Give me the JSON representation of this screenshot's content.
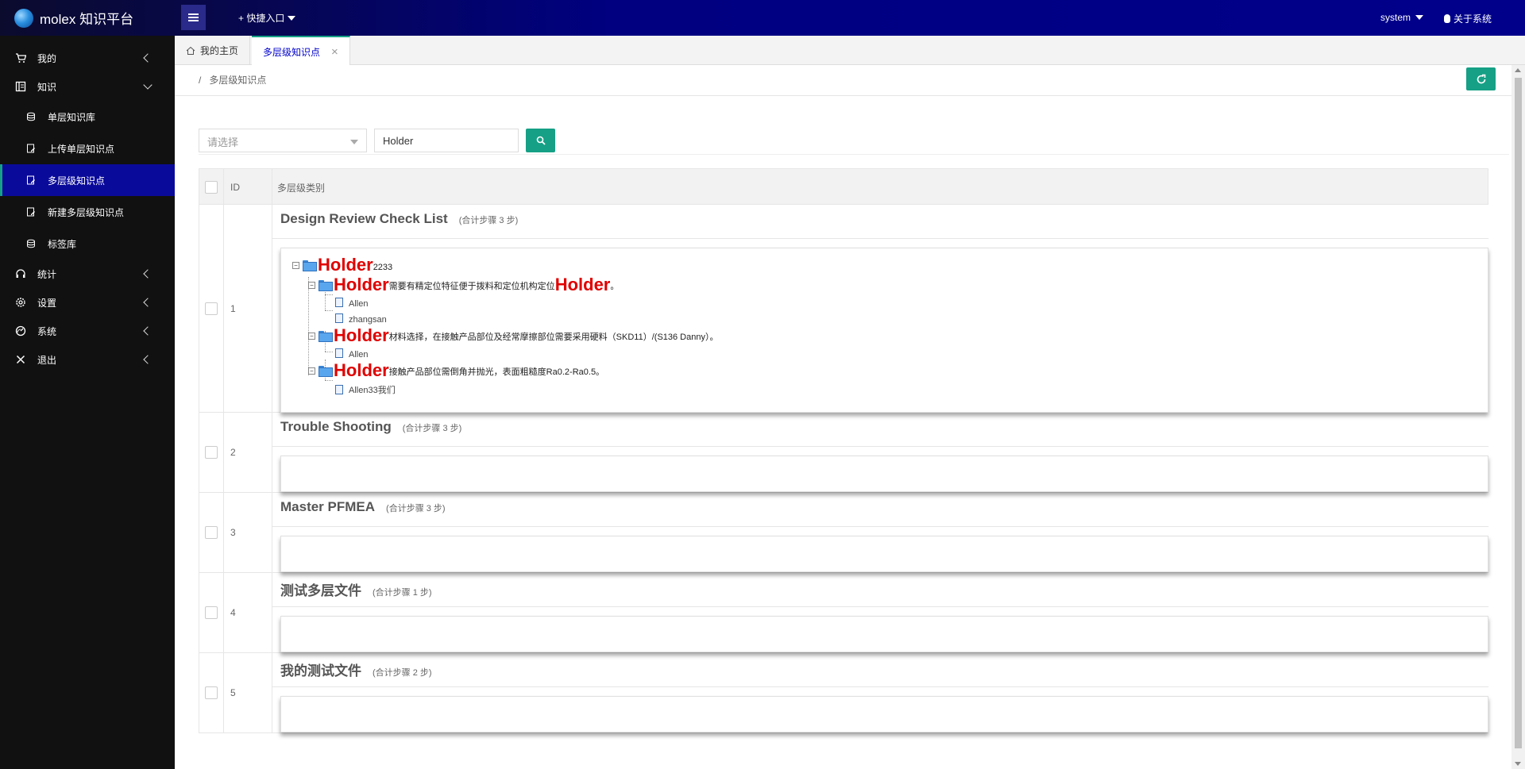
{
  "header": {
    "brand": "molex 知识平台",
    "quick_entry": "+ 快捷入口",
    "user": "system",
    "about": "关于系统"
  },
  "sidebar": {
    "items": [
      {
        "label": "我的",
        "icon": "cart-icon"
      },
      {
        "label": "知识",
        "icon": "book-icon"
      },
      {
        "label": "统计",
        "icon": "headset-icon"
      },
      {
        "label": "设置",
        "icon": "gear-icon"
      },
      {
        "label": "系统",
        "icon": "dashboard-icon"
      },
      {
        "label": "退出",
        "icon": "close-icon"
      }
    ],
    "subitems": [
      {
        "label": "单层知识库",
        "icon": "database-icon"
      },
      {
        "label": "上传单层知识点",
        "icon": "edit-doc-icon"
      },
      {
        "label": "多层级知识点",
        "icon": "edit-doc-icon",
        "active": true
      },
      {
        "label": "新建多层级知识点",
        "icon": "edit-doc-icon"
      },
      {
        "label": "标签库",
        "icon": "database-icon"
      }
    ]
  },
  "tabs": [
    {
      "label": "我的主页",
      "icon": "home-icon"
    },
    {
      "label": "多层级知识点",
      "active": true
    }
  ],
  "breadcrumb": {
    "sep": "/",
    "current": "多层级知识点"
  },
  "filter": {
    "select_placeholder": "请选择",
    "search_value": "Holder"
  },
  "table": {
    "columns": [
      "ID",
      "多层级类别"
    ],
    "rows": [
      {
        "id": "1",
        "title": "Design Review Check List",
        "summary": "(合计步骤 3 步)"
      },
      {
        "id": "2",
        "title": "Trouble Shooting",
        "summary": "(合计步骤 3 步)"
      },
      {
        "id": "3",
        "title": "Master PFMEA",
        "summary": "(合计步骤 3 步)"
      },
      {
        "id": "4",
        "title": "测试多层文件",
        "summary": "(合计步骤 1 步)"
      },
      {
        "id": "5",
        "title": "我的测试文件",
        "summary": "(合计步骤 2 步)"
      }
    ]
  },
  "tree": {
    "root": {
      "highlight": "Holder",
      "suffix": "2233"
    },
    "nodes": [
      {
        "highlight": "Holder",
        "text": "需要有精定位特征便于拨料和定位机构定位",
        "tail_highlight": "Holder",
        "tail": "。",
        "children": [
          "Allen",
          "zhangsan"
        ]
      },
      {
        "highlight": "Holder",
        "text": "材料选择，在接触产品部位及经常摩擦部位需要采用硬料（SKD11）/(S136 Danny）。",
        "children": [
          "Allen"
        ]
      },
      {
        "highlight": "Holder",
        "text": "接触产品部位需倒角并抛光，表面粗糙度Ra0.2-Ra0.5。",
        "children": [
          "Allen33我们"
        ]
      }
    ]
  },
  "colors": {
    "accent": "#16a085",
    "header_blue": "#000080",
    "active_nav": "#0a0a9a",
    "highlight_red": "#e00000"
  }
}
